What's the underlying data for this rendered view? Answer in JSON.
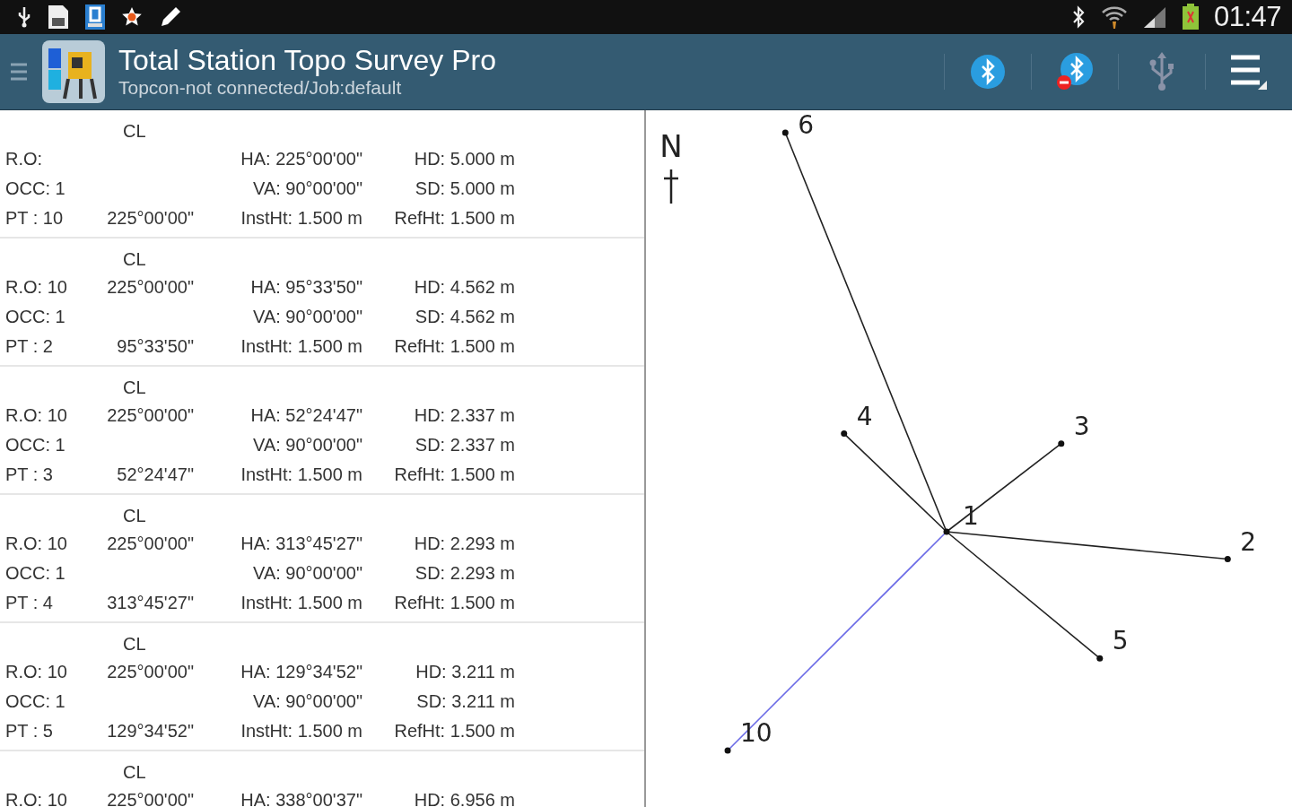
{
  "status_bar": {
    "time": "01:47"
  },
  "action_bar": {
    "title": "Total Station Topo Survey Pro",
    "subtitle": "Topcon-not connected/Job:default"
  },
  "records": [
    {
      "title": "CL",
      "ro": "R.O:",
      "ha": "HA: 225°00'00\"",
      "hd": "HD: 5.000 m",
      "occ": "OCC: 1",
      "va": "VA: 90°00'00\"",
      "sd": "SD: 5.000 m",
      "pt": "PT : 10",
      "pt_angle": "225°00'00\"",
      "inst": "InstHt: 1.500 m",
      "ref": "RefHt: 1.500 m"
    },
    {
      "title": "CL",
      "ro": "R.O: 10",
      "ro_angle": "225°00'00\"",
      "ha": "HA: 95°33'50\"",
      "hd": "HD: 4.562 m",
      "occ": "OCC: 1",
      "va": "VA: 90°00'00\"",
      "sd": "SD: 4.562 m",
      "pt": "PT : 2",
      "pt_angle": "95°33'50\"",
      "inst": "InstHt: 1.500 m",
      "ref": "RefHt: 1.500 m"
    },
    {
      "title": "CL",
      "ro": "R.O: 10",
      "ro_angle": "225°00'00\"",
      "ha": "HA: 52°24'47\"",
      "hd": "HD: 2.337 m",
      "occ": "OCC: 1",
      "va": "VA: 90°00'00\"",
      "sd": "SD: 2.337 m",
      "pt": "PT : 3",
      "pt_angle": "52°24'47\"",
      "inst": "InstHt: 1.500 m",
      "ref": "RefHt: 1.500 m"
    },
    {
      "title": "CL",
      "ro": "R.O: 10",
      "ro_angle": "225°00'00\"",
      "ha": "HA: 313°45'27\"",
      "hd": "HD: 2.293 m",
      "occ": "OCC: 1",
      "va": "VA: 90°00'00\"",
      "sd": "SD: 2.293 m",
      "pt": "PT : 4",
      "pt_angle": "313°45'27\"",
      "inst": "InstHt: 1.500 m",
      "ref": "RefHt: 1.500 m"
    },
    {
      "title": "CL",
      "ro": "R.O: 10",
      "ro_angle": "225°00'00\"",
      "ha": "HA: 129°34'52\"",
      "hd": "HD: 3.211 m",
      "occ": "OCC: 1",
      "va": "VA: 90°00'00\"",
      "sd": "SD: 3.211 m",
      "pt": "PT : 5",
      "pt_angle": "129°34'52\"",
      "inst": "InstHt: 1.500 m",
      "ref": "RefHt: 1.500 m"
    },
    {
      "title": "CL",
      "ro": "R.O: 10",
      "ro_angle": "225°00'00\"",
      "ha": "HA: 338°00'37\"",
      "hd": "HD: 6.956 m"
    }
  ],
  "plot": {
    "north": "N",
    "station": "1",
    "points": [
      {
        "label": "10",
        "kind": "backsight"
      },
      {
        "label": "2",
        "kind": "shot"
      },
      {
        "label": "3",
        "kind": "shot"
      },
      {
        "label": "4",
        "kind": "shot"
      },
      {
        "label": "5",
        "kind": "shot"
      },
      {
        "label": "6",
        "kind": "shot"
      }
    ]
  }
}
